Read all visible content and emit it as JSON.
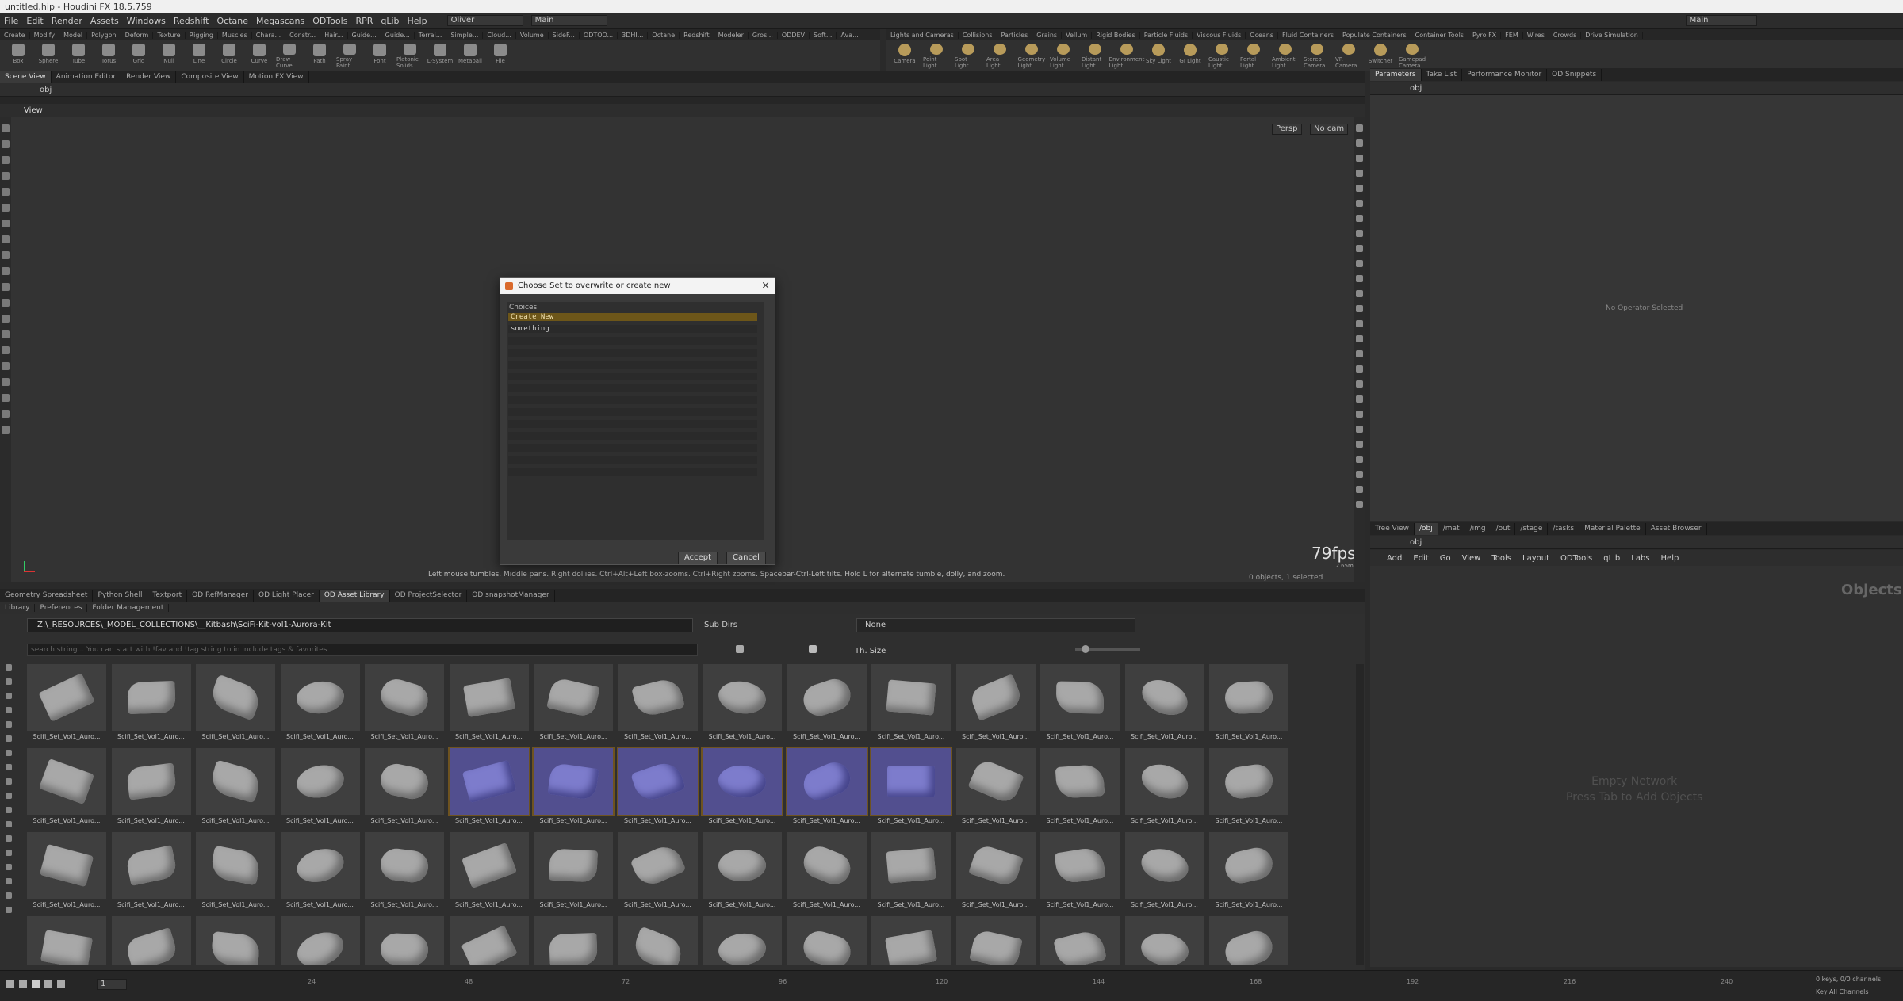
{
  "window_title": "untitled.hip - Houdini FX 18.5.759",
  "menu": [
    "File",
    "Edit",
    "Render",
    "Assets",
    "Windows",
    "Redshift",
    "Octane",
    "Megascans",
    "ODTools",
    "RPR",
    "qLib",
    "Help"
  ],
  "desktop_dropdown": "Oliver",
  "layout_dropdown": "Main",
  "right_layout": "Main",
  "shelf_tabs_left": [
    "Create",
    "Modify",
    "Model",
    "Polygon",
    "Deform",
    "Texture",
    "Rigging",
    "Muscles",
    "Chara...",
    "Constr...",
    "Hair...",
    "Guide...",
    "Guide...",
    "Terrai...",
    "Simple...",
    "Cloud...",
    "Volume",
    "SideF...",
    "ODTOO...",
    "3DHI...",
    "Octane",
    "Redshift",
    "Modeler",
    "Gros...",
    "ODDEV",
    "Soft...",
    "Ava..."
  ],
  "shelf_tools_left": [
    "Box",
    "Sphere",
    "Tube",
    "Torus",
    "Grid",
    "Null",
    "Line",
    "Circle",
    "Curve",
    "Draw Curve",
    "Path",
    "Spray Paint",
    "Font",
    "Platonic Solids",
    "L-System",
    "Metaball",
    "File"
  ],
  "shelf_tabs_right": [
    "Lights and Cameras",
    "Collisions",
    "Particles",
    "Grains",
    "Vellum",
    "Rigid Bodies",
    "Particle Fluids",
    "Viscous Fluids",
    "Oceans",
    "Fluid Containers",
    "Populate Containers",
    "Container Tools",
    "Pyro FX",
    "FEM",
    "Wires",
    "Crowds",
    "Drive Simulation"
  ],
  "shelf_tools_right": [
    "Camera",
    "Point Light",
    "Spot Light",
    "Area Light",
    "Geometry Light",
    "Volume Light",
    "Distant Light",
    "Environment Light",
    "Sky Light",
    "GI Light",
    "Caustic Light",
    "Portal Light",
    "Ambient Light",
    "Stereo Camera",
    "VR Camera",
    "Switcher",
    "Gamepad Camera"
  ],
  "viewer_tabs": [
    "Scene View",
    "Animation Editor",
    "Render View",
    "Composite View",
    "Motion FX View"
  ],
  "viewer_path": "obj",
  "view_label": "View",
  "persp_label": "Persp",
  "cam_label": "No cam",
  "fps": "79fps",
  "fps_sub": "12.65ms",
  "status_hint": "Left mouse tumbles. Middle pans. Right dollies. Ctrl+Alt+Left box-zooms. Ctrl+Right zooms. Spacebar-Ctrl-Left tilts. Hold L for alternate tumble, dolly, and zoom.",
  "objects_selected": "0 objects, 1 selected",
  "dialog": {
    "title": "Choose Set to overwrite or create new",
    "choices_header": "Choices",
    "items": [
      "Create New",
      "something"
    ],
    "accept": "Accept",
    "cancel": "Cancel"
  },
  "bottom_tabs": [
    "Geometry Spreadsheet",
    "Python Shell",
    "Textport",
    "OD RefManager",
    "OD Light Placer",
    "OD Asset Library",
    "OD ProjectSelector",
    "OD snapshotManager"
  ],
  "library_tabs": [
    "Library",
    "Preferences",
    "Folder Management"
  ],
  "library_path": "Z:\\_RESOURCES\\_MODEL_COLLECTIONS\\__Kitbash\\SciFi-Kit-vol1-Aurora-Kit",
  "subdirs_label": "Sub Dirs",
  "subdirs_value": "None",
  "search_placeholder": "search string... You can start with !fav and !tag string to in include tags & favorites",
  "thsize_label": "Th. Size",
  "asset_caption": "Scifi_Set_Vol1_Auro...",
  "param_tabs": [
    "Parameters",
    "Take List",
    "Performance Monitor",
    "OD Snippets"
  ],
  "param_path": "obj",
  "no_operator": "No Operator Selected",
  "net_tabs": [
    "Tree View",
    "/obj",
    "/mat",
    "/img",
    "/out",
    "/stage",
    "/tasks",
    "Material Palette",
    "Asset Browser"
  ],
  "net_path": "obj",
  "net_menu": [
    "Add",
    "Edit",
    "Go",
    "View",
    "Tools",
    "Layout",
    "ODTools",
    "qLib",
    "Labs",
    "Help"
  ],
  "net_objects_label": "Objects",
  "empty_network": "Empty Network",
  "empty_hint": "Press Tab to Add Objects",
  "timeline_frame": "1",
  "timeline_ticks": [
    "24",
    "48",
    "72",
    "96",
    "120",
    "144",
    "168",
    "192",
    "216",
    "240"
  ],
  "keys_label": "0 keys, 0/0 channels",
  "key_all": "Key All Channels"
}
